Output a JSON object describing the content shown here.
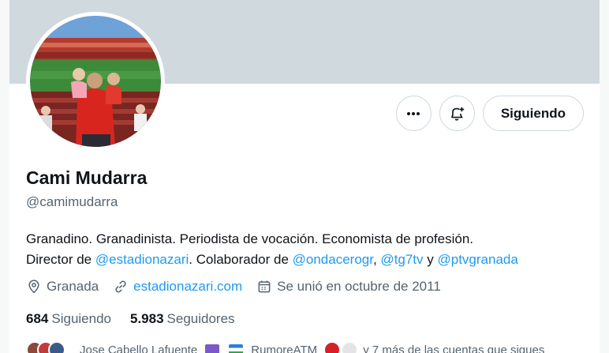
{
  "profile": {
    "name": "Cami Mudarra",
    "handle": "@camimudarra",
    "bio": {
      "line1": "Granadino. Granadinista. Periodista de vocación. Economista de profesión.",
      "line2_prefix": "Director de ",
      "mention_1": "@estadionazari",
      "line2_mid": ". Colaborador de ",
      "mention_2": "@ondacerogr",
      "comma": ", ",
      "mention_3": "@tg7tv",
      "and": " y ",
      "mention_4": "@ptvgranada"
    },
    "location": "Granada",
    "website": "estadionazari.com",
    "joined": "Se unió en octubre de 2011"
  },
  "actions": {
    "more_icon": "more-icon",
    "notify_icon": "bell-plus-icon",
    "follow_label": "Siguiendo"
  },
  "stats": {
    "following_count": "684",
    "following_label": "Siguiendo",
    "followers_count": "5.983",
    "followers_label": "Seguidores"
  },
  "followed_by": {
    "name_1": "Jose Cabello Lafuente",
    "name_2": "RumoreATM",
    "suffix": "y 7 más de las cuentas que sigues"
  },
  "colors": {
    "accent": "#1d9bf0",
    "banner": "#cfd9de",
    "secondary_text": "#536471",
    "primary_text": "#0f1419"
  }
}
